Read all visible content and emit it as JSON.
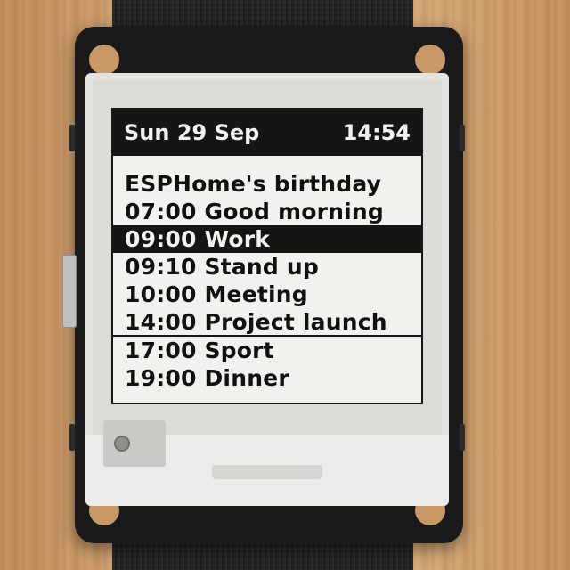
{
  "screen": {
    "header": {
      "date": "Sun 29 Sep",
      "time": "14:54"
    },
    "events": [
      {
        "label": "ESPHome's birthday",
        "highlighted": false
      },
      {
        "label": "07:00 Good morning",
        "highlighted": false
      },
      {
        "label": "09:00 Work",
        "highlighted": true
      },
      {
        "label": "09:10 Stand up",
        "highlighted": false
      },
      {
        "label": "10:00 Meeting",
        "highlighted": false
      },
      {
        "label": "14:00 Project launch",
        "highlighted": false
      },
      {
        "label": "17:00 Sport",
        "highlighted": false
      },
      {
        "label": "19:00 Dinner",
        "highlighted": false
      }
    ]
  },
  "colors": {
    "ink": "#151515",
    "paper": "#f1f1ee",
    "wood": "#c89866",
    "strap": "#1c1c1c"
  }
}
